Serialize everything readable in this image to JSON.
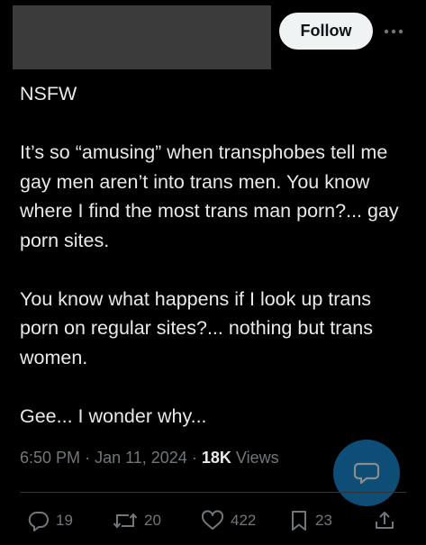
{
  "header": {
    "follow_label": "Follow",
    "more_icon": "more-horizontal-icon"
  },
  "post": {
    "lines": [
      "NSFW",
      "",
      "It’s so “amusing” when transphobes tell me gay men aren’t into trans men. You know where I find the most trans man porn?... gay porn sites.",
      "",
      "You know what happens if I look up trans porn on regular sites?... nothing but trans women.",
      "",
      "Gee... I wonder why..."
    ]
  },
  "meta": {
    "time": "6:50 PM",
    "date": "Jan 11, 2024",
    "views_count": "18K",
    "views_label": "Views"
  },
  "actions": {
    "replies": "19",
    "reposts": "20",
    "likes": "422",
    "bookmarks": "23"
  },
  "colors": {
    "background": "#000000",
    "text": "#e7e9ea",
    "muted": "#71767b",
    "accent": "#1a8cd8"
  }
}
